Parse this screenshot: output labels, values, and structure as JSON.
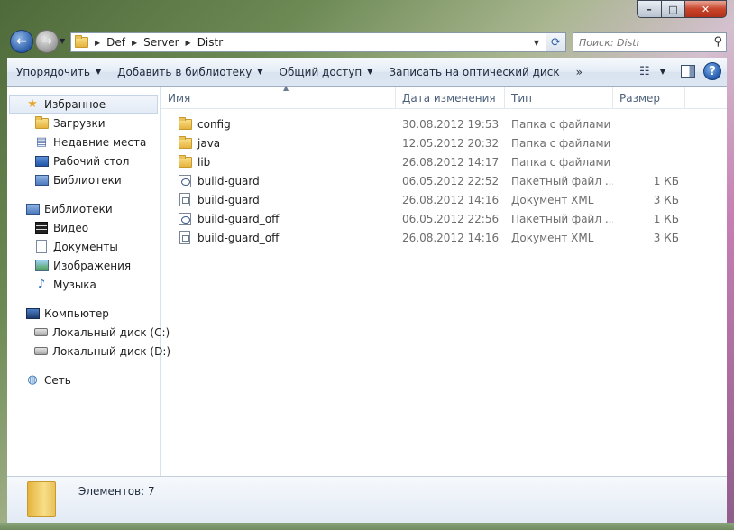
{
  "window": {
    "minimize": "–",
    "maximize": "□",
    "close": "✕"
  },
  "nav": {
    "breadcrumbs": [
      "Def",
      "Server",
      "Distr"
    ],
    "search_placeholder": "Поиск: Distr"
  },
  "toolbar": {
    "organize": "Упорядочить",
    "add_to_library": "Добавить в библиотеку",
    "share": "Общий доступ",
    "burn": "Записать на оптический диск",
    "more": "»"
  },
  "sidebar": {
    "favorites": "Избранное",
    "downloads": "Загрузки",
    "recent": "Недавние места",
    "desktop": "Рабочий стол",
    "libraries_link": "Библиотеки",
    "libraries": "Библиотеки",
    "video": "Видео",
    "documents": "Документы",
    "images": "Изображения",
    "music": "Музыка",
    "computer": "Компьютер",
    "disk_c": "Локальный диск (C:)",
    "disk_d": "Локальный диск (D:)",
    "network": "Сеть"
  },
  "columns": {
    "name": "Имя",
    "date": "Дата изменения",
    "type": "Тип",
    "size": "Размер"
  },
  "files": [
    {
      "name": "config",
      "date": "30.08.2012 19:53",
      "type": "Папка с файлами",
      "size": "",
      "icon": "folder-icon"
    },
    {
      "name": "java",
      "date": "12.05.2012 20:32",
      "type": "Папка с файлами",
      "size": "",
      "icon": "folder-icon"
    },
    {
      "name": "lib",
      "date": "26.08.2012 14:17",
      "type": "Папка с файлами",
      "size": "",
      "icon": "folder-icon"
    },
    {
      "name": "build-guard",
      "date": "06.05.2012 22:52",
      "type": "Пакетный файл ...",
      "size": "1 КБ",
      "icon": "batch-file-icon"
    },
    {
      "name": "build-guard",
      "date": "26.08.2012 14:16",
      "type": "Документ XML",
      "size": "3 КБ",
      "icon": "xml-file-icon"
    },
    {
      "name": "build-guard_off",
      "date": "06.05.2012 22:56",
      "type": "Пакетный файл ...",
      "size": "1 КБ",
      "icon": "batch-file-icon"
    },
    {
      "name": "build-guard_off",
      "date": "26.08.2012 14:16",
      "type": "Документ XML",
      "size": "3 КБ",
      "icon": "xml-file-icon"
    }
  ],
  "status": {
    "count": "Элементов: 7"
  }
}
